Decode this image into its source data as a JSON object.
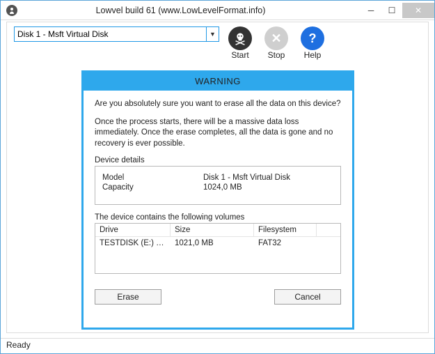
{
  "titlebar": {
    "title": "Lowvel build 61 (www.LowLevelFormat.info)"
  },
  "toolbar": {
    "disk_selected": "Disk 1 - Msft Virtual Disk",
    "start_label": "Start",
    "stop_label": "Stop",
    "help_label": "Help"
  },
  "dialog": {
    "title": "WARNING",
    "line1": "Are you absolutely sure you want to erase all the data on this device?",
    "line2": "Once the process starts, there will be a massive data loss immediately. Once the erase completes, all the data is gone and no recovery is ever possible.",
    "details_label": "Device details",
    "model_label": "Model",
    "model_value": "Disk 1 - Msft Virtual Disk",
    "capacity_label": "Capacity",
    "capacity_value": "1024,0 MB",
    "volumes_label": "The device contains the following volumes",
    "col_drive": "Drive",
    "col_size": "Size",
    "col_fs": "Filesystem",
    "vol_drive": "TESTDISK (E:) (FAT…",
    "vol_size": "1021,0 MB",
    "vol_fs": "FAT32",
    "erase_btn": "Erase",
    "cancel_btn": "Cancel"
  },
  "status": {
    "text": "Ready"
  }
}
